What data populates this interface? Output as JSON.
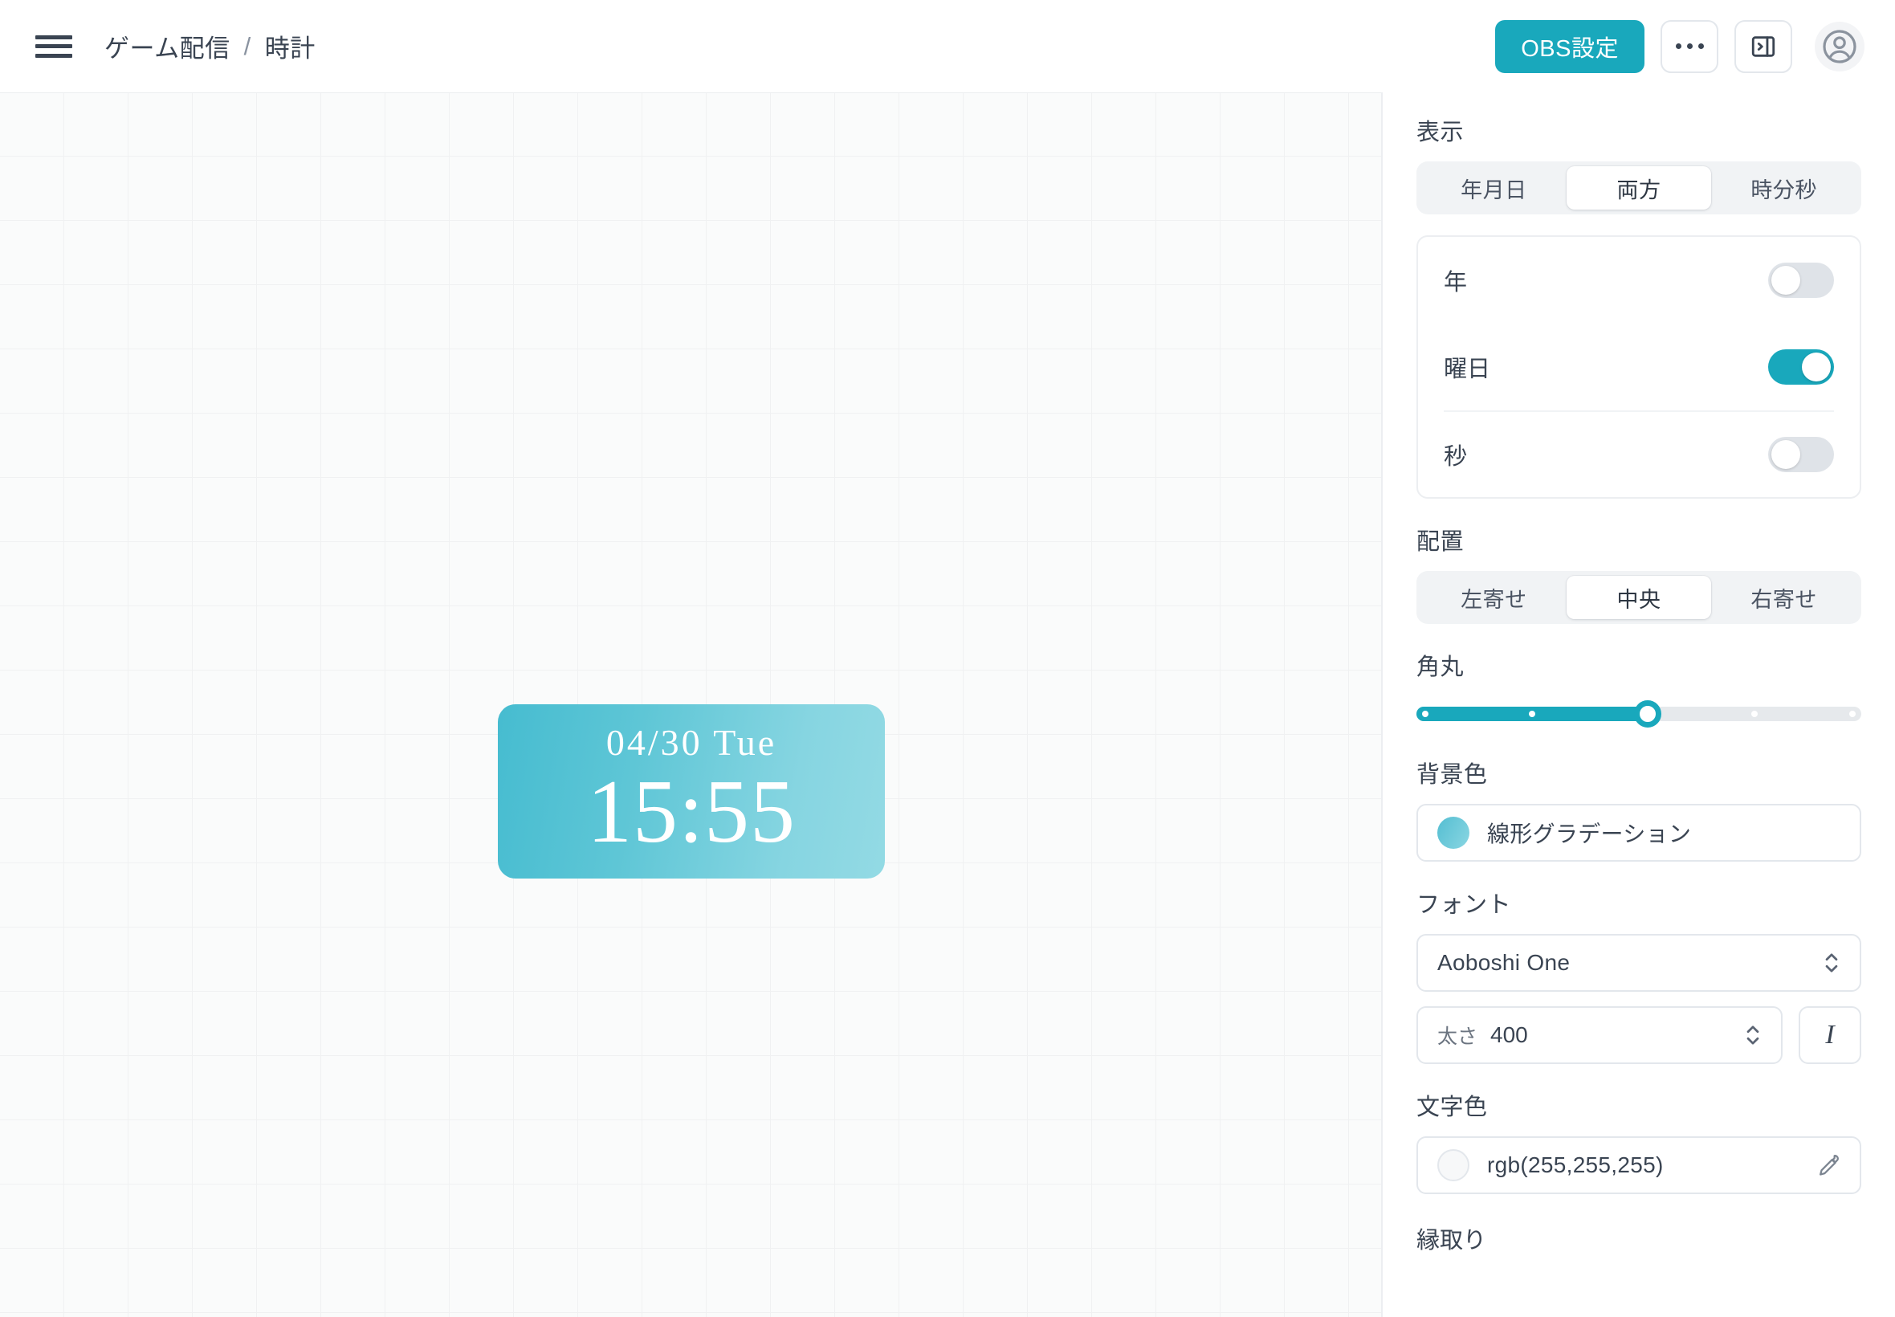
{
  "topbar": {
    "menu_icon": "hamburger-menu-icon",
    "breadcrumb": {
      "parent": "ゲーム配信",
      "separator": "/",
      "current": "時計"
    },
    "obs_button_label": "OBS設定",
    "more_icon": "ellipsis-icon",
    "panel_toggle_icon": "panel-right-expand-icon",
    "avatar_icon": "user-avatar-icon",
    "accent_color": "#19a8bc"
  },
  "canvas": {
    "grid_size_px": 80,
    "background_color": "#fafbfb",
    "widget": {
      "date_text": "04/30 Tue",
      "time_text": "15:55",
      "text_color": "rgb(255,255,255)",
      "gradient_from": "#46bcd0",
      "gradient_to": "#93dae4"
    }
  },
  "sidebar": {
    "display": {
      "label": "表示",
      "modes": [
        "年月日",
        "両方",
        "時分秒"
      ],
      "selected_mode": "両方",
      "toggles": [
        {
          "label": "年",
          "on": false
        },
        {
          "label": "曜日",
          "on": true
        },
        {
          "label": "秒",
          "on": false
        }
      ]
    },
    "alignment": {
      "label": "配置",
      "options": [
        "左寄せ",
        "中央",
        "右寄せ"
      ],
      "selected": "中央"
    },
    "corner_radius": {
      "label": "角丸",
      "value": 2,
      "min": 0,
      "max": 4,
      "ticks": 5,
      "percent": 52
    },
    "background_color": {
      "label": "背景色",
      "value": "線形グラデーション",
      "swatch_icon": "gradient-swatch-icon"
    },
    "font": {
      "label": "フォント",
      "family": "Aoboshi One",
      "weight_label": "太さ",
      "weight_value": "400",
      "italic_icon": "italic-icon",
      "stepper_icon": "chevron-updown-icon"
    },
    "text_color": {
      "label": "文字色",
      "value": "rgb(255,255,255)",
      "swatch_icon": "color-swatch-icon",
      "picker_icon": "eyedropper-icon"
    },
    "outline": {
      "label": "縁取り"
    }
  }
}
